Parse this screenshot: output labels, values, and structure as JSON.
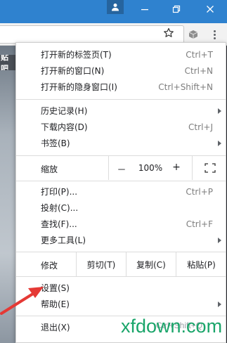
{
  "left_tab_text": "贴吧",
  "menu": {
    "group1": [
      {
        "label": "打开新的标签页(T)",
        "shortcut": "Ctrl+T"
      },
      {
        "label": "打开新的窗口(N)",
        "shortcut": "Ctrl+N"
      },
      {
        "label": "打开新的隐身窗口(I)",
        "shortcut": "Ctrl+Shift+N"
      }
    ],
    "group2": [
      {
        "label": "历史记录(H)",
        "shortcut": ""
      },
      {
        "label": "下载内容(D)",
        "shortcut": "Ctrl+J"
      },
      {
        "label": "书签(B)",
        "shortcut": ""
      }
    ],
    "zoom": {
      "label": "缩放",
      "minus": "－",
      "value": "100%",
      "plus": "+"
    },
    "group3": [
      {
        "label": "打印(P)...",
        "shortcut": "Ctrl+P"
      },
      {
        "label": "投射(C)...",
        "shortcut": ""
      },
      {
        "label": "查找(F)...",
        "shortcut": "Ctrl+F"
      },
      {
        "label": "更多工具(L)",
        "shortcut": ""
      }
    ],
    "edit": {
      "label": "修改",
      "cut": "剪切(T)",
      "copy": "复制(C)",
      "paste": "粘贴(P)"
    },
    "group4": [
      {
        "label": "设置(S)",
        "shortcut": ""
      },
      {
        "label": "帮助(E)",
        "shortcut": ""
      }
    ],
    "exit": {
      "label": "退出(X)",
      "shortcut": "Ctrl+Shift+Q"
    }
  },
  "watermark": {
    "text": "xfdown.com",
    "sub": "Ctrl+Shift+Q"
  },
  "colors": {
    "titlebar": "#2f82cf",
    "accent_arrow": "#e53935",
    "watermark": "#1aa56a"
  }
}
